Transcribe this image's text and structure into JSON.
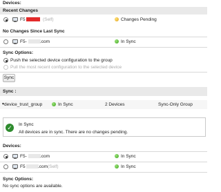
{
  "devices_header": "Devices:",
  "recent_changes_title": "Recent Changes",
  "recent_device": {
    "name_prefix": "F5",
    "self_tag": "(Self)",
    "status": "Changes Pending"
  },
  "no_changes_title": "No Changes Since Last Sync",
  "other_device": {
    "name_prefix": "F5-",
    "name_suffix": ".com",
    "status": "In Sync"
  },
  "sync_options_label": "Sync Options:",
  "sync_options": [
    {
      "label": "Push the selected device configuration to the group",
      "selected": true,
      "disabled": false
    },
    {
      "label": "Pull the most recent configuration to the selected device",
      "selected": false,
      "disabled": true
    }
  ],
  "sync_button": "Sync",
  "sync_section": {
    "title": "Sync :"
  },
  "group_row": {
    "name": "device_trust_group",
    "status": "In Sync",
    "device_count": "2 Devices",
    "group_type": "Sync-Only Group"
  },
  "info_box": {
    "title": "In Sync",
    "message": "All devices are in sync. There are no changes pending."
  },
  "devices_header_2": "Devices:",
  "devices_list": [
    {
      "name_prefix": "F5-",
      "name_suffix": ".com",
      "self_tag": "",
      "status": "In Sync",
      "selected": true
    },
    {
      "name_prefix": "F5",
      "name_suffix": ".com",
      "self_tag": "(Self)",
      "status": "In Sync",
      "selected": false
    }
  ],
  "sync_options_label_2": "Sync Options:",
  "no_sync_options_text": "No sync options are available.",
  "colors": {
    "in_sync": "#3ea51c",
    "pending": "#e2a21a",
    "redaction": "#e32b2b",
    "success": "#2e8b2e"
  }
}
